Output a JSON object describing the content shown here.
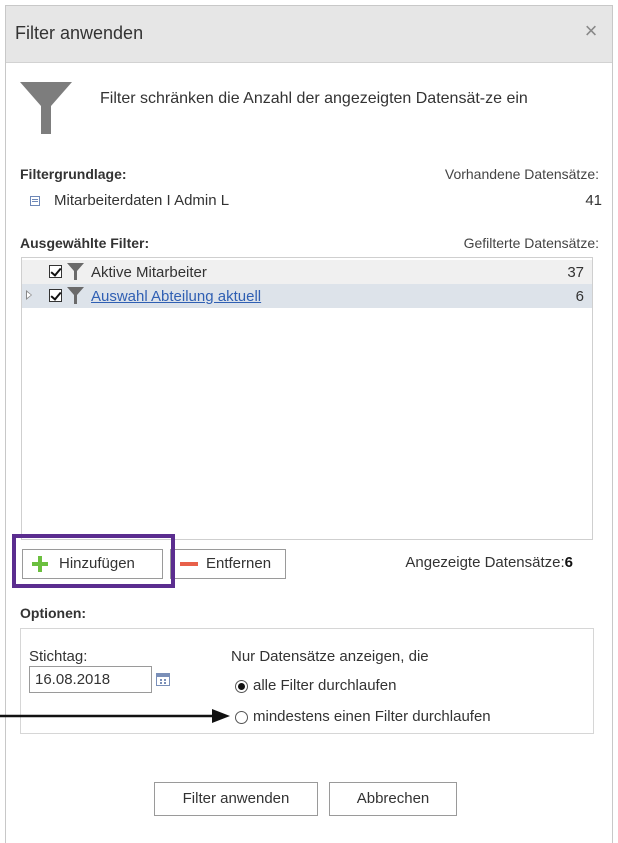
{
  "dialog": {
    "title": "Filter anwenden",
    "close_symbol": "×",
    "intro_icon": "funnel-icon",
    "intro_text": "Filter schränken die Anzahl der angezeigten Datensät-ze ein"
  },
  "base": {
    "label": "Filtergrundlage:",
    "right_label": "Vorhandene Datensätze:",
    "icon": "database-table-icon",
    "name": "Mitarbeiterdaten I Admin L",
    "count": "41"
  },
  "filters": {
    "label": "Ausgewählte Filter:",
    "right_label": "Gefilterte Datensätze:",
    "items": [
      {
        "name": "Aktive Mitarbeiter",
        "count": "37",
        "checked": true,
        "link": false
      },
      {
        "name": "Auswahl Abteilung aktuell",
        "count": "6",
        "checked": true,
        "link": true,
        "expandable": true
      }
    ]
  },
  "actions": {
    "add_label": "Hinzufügen",
    "remove_label": "Entfernen",
    "shown_label": "Angezeigte Datensätze:",
    "shown_count": "6"
  },
  "options": {
    "label": "Optionen:",
    "date_label": "Stichtag:",
    "date_value": "16.08.2018",
    "condition_label": "Nur Datensätze anzeigen, die",
    "radios": [
      {
        "label": "alle Filter durchlaufen",
        "selected": true
      },
      {
        "label": "mindestens einen Filter durchlaufen",
        "selected": false
      }
    ]
  },
  "footer": {
    "apply_label": "Filter anwenden",
    "cancel_label": "Abbrechen"
  },
  "colors": {
    "titlebar": "#e6e6e6",
    "selected_row": "#dde3ea",
    "link": "#2f5fb3",
    "add_icon": "#6bbf3f",
    "remove_icon": "#e8604a",
    "highlight_box": "#5b2d8f"
  }
}
